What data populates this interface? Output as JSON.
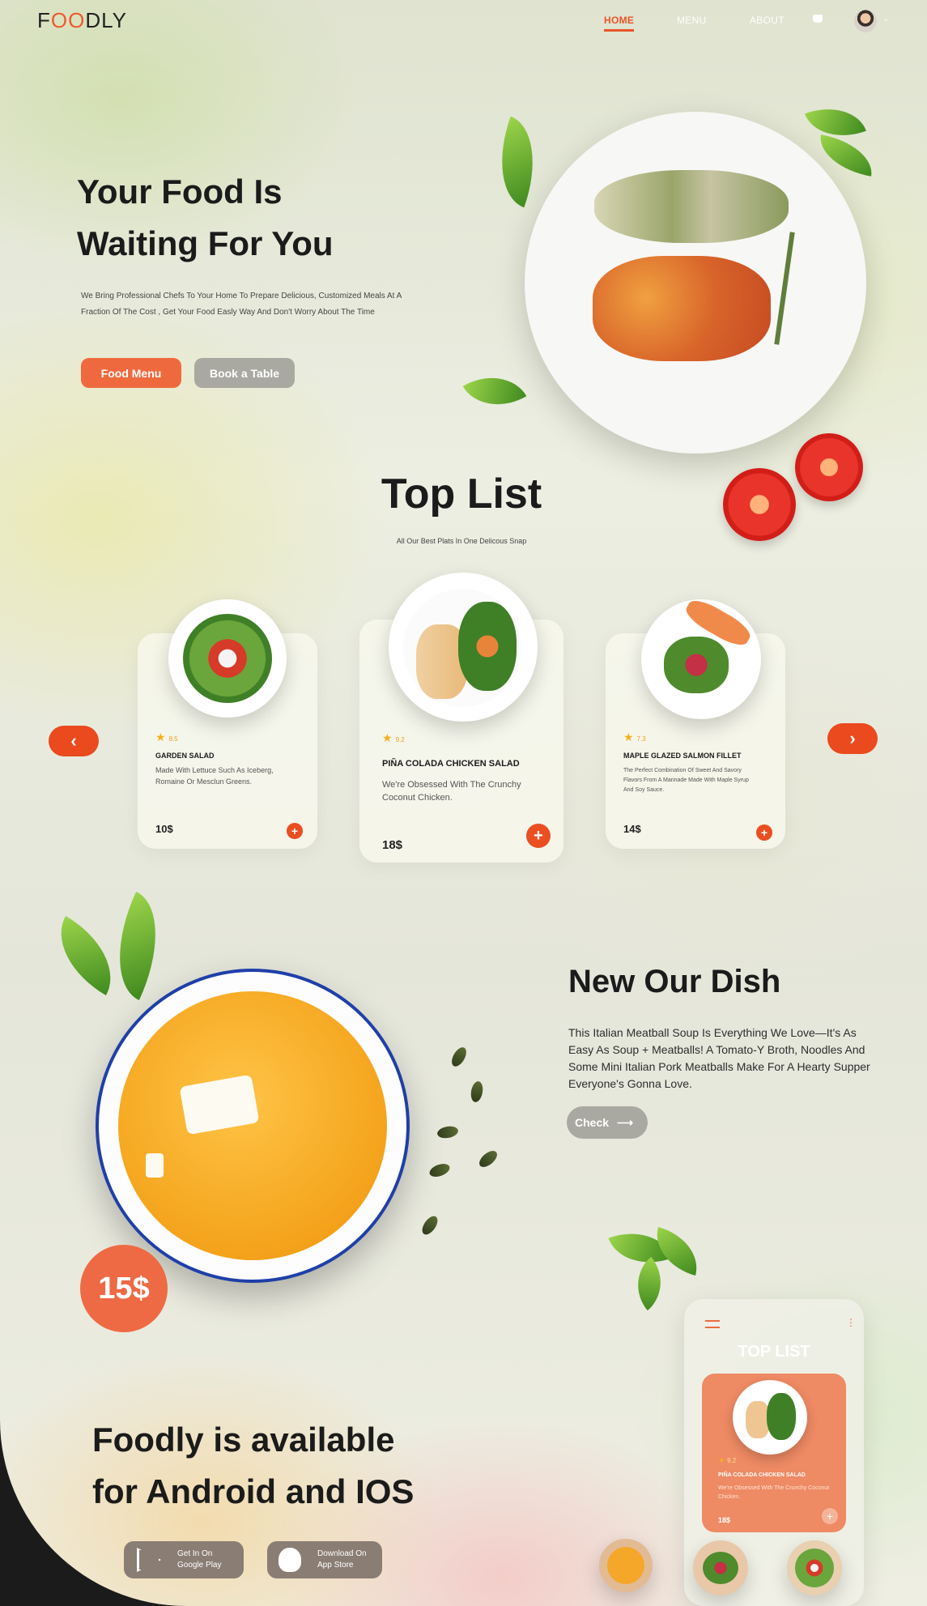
{
  "brand": {
    "prefix": "F",
    "highlight": "OO",
    "suffix": "DLY"
  },
  "nav": {
    "home": "HOME",
    "menu": "MENU",
    "about": "ABOUT"
  },
  "hero": {
    "title_line1": "Your Food Is",
    "title_line2": "Waiting For You",
    "description": "We Bring Professional Chefs To Your Home To Prepare Delicious, Customized Meals At A Fraction Of The Cost , Get Your Food Easly Way And Don't Worry About The Time",
    "primary_button": "Food Menu",
    "secondary_button": "Book a Table"
  },
  "top_list": {
    "title": "Top  List",
    "subtitle": "All Our Best Plats In One Delicous Snap",
    "prev_icon": "‹",
    "next_icon": "›",
    "items": [
      {
        "rating": "8.5",
        "name": "GARDEN SALAD",
        "desc": "Made With Lettuce Such As Iceberg, Romaine Or Mesclun Greens.",
        "price": "10$"
      },
      {
        "rating": "9.2",
        "name": "PIÑA COLADA CHICKEN SALAD",
        "desc": "We're Obsessed With The Crunchy Coconut Chicken.",
        "price": "18$"
      },
      {
        "rating": "7.3",
        "name": "MAPLE GLAZED SALMON FILLET",
        "desc": "The Perfect Combination Of Sweet And Savory Flavors From A Marinade Made With Maple Syrup And Soy Sauce.",
        "price": "14$"
      }
    ]
  },
  "dish": {
    "title": "New Our Dish",
    "description": "This Italian Meatball Soup Is Everything We Love—It's As Easy As Soup + Meatballs! A Tomato-Y Broth, Noodles And Some Mini Italian Pork Meatballs Make For A Hearty Supper Everyone's Gonna Love.",
    "button": "Check",
    "price": "15$"
  },
  "app": {
    "title_line1": "Foodly is available",
    "title_line2": "for Android and IOS",
    "google": {
      "line1": "Get In On",
      "line2": "Google Play"
    },
    "apple": {
      "line1": "Download On",
      "line2": "App Store"
    },
    "phone": {
      "title": "TOP LIST",
      "rating": "9.2",
      "item_name": "PIÑA COLADA CHICKEN SALAD",
      "item_desc": "We're Obsessed With The Crunchy Coconut Chicken.",
      "price": "18$"
    }
  },
  "colors": {
    "accent": "#ec5a2d",
    "button_gray": "#a9a9a1",
    "bowl_rim": "#1f3fa8"
  }
}
